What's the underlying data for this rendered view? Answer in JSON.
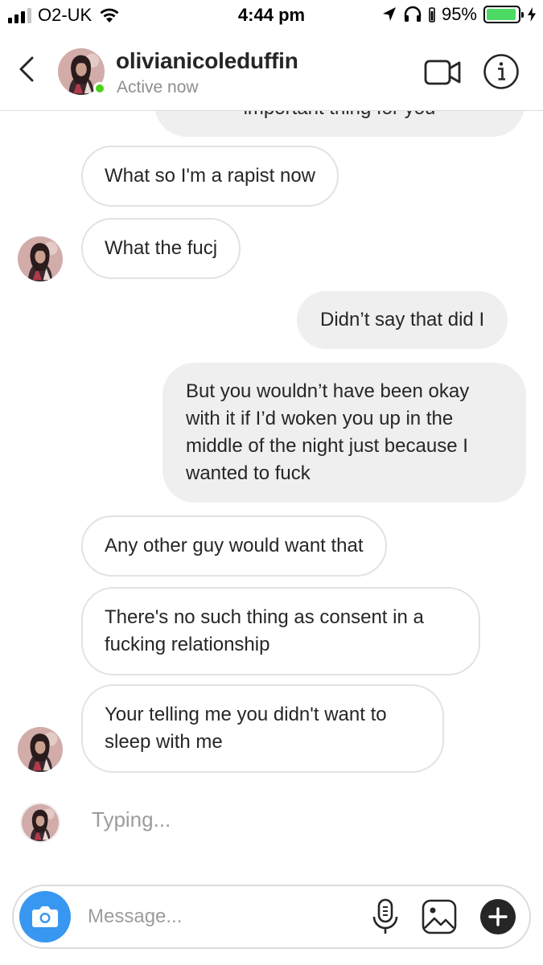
{
  "status_bar": {
    "carrier": "O2-UK",
    "time": "4:44 pm",
    "battery_percent": "95%",
    "battery_level": 0.95,
    "signal_bars": 3,
    "icons": [
      "signal-icon",
      "wifi-icon",
      "location-arrow-icon",
      "headphones-icon",
      "battery-icon",
      "charging-icon"
    ]
  },
  "header": {
    "username": "olivianicoleduffin",
    "status": "Active now",
    "icons": [
      "back-chevron-icon",
      "video-call-icon",
      "info-icon"
    ],
    "online_color": "#4bd11b"
  },
  "messages": [
    {
      "from": "me",
      "text": "important thing for you",
      "partially_hidden": true
    },
    {
      "from": "them",
      "text": "What so I'm a rapist now"
    },
    {
      "from": "them",
      "text": "What the fucj"
    },
    {
      "from": "me",
      "text": "Didn’t say that did I"
    },
    {
      "from": "me",
      "text": "But you wouldn’t have been okay with it if I’d woken you up in the middle of the night just because I wanted to fuck"
    },
    {
      "from": "them",
      "text": "Any other guy would want that"
    },
    {
      "from": "them",
      "text": "There's no such thing as consent in a fucking relationship"
    },
    {
      "from": "them",
      "text": "Your telling me you didn't want to sleep with me"
    }
  ],
  "typing_indicator": "Typing...",
  "composer": {
    "placeholder": "Message...",
    "icons": [
      "camera-icon",
      "microphone-icon",
      "gallery-icon",
      "plus-icon"
    ],
    "camera_color": "#3897f0"
  },
  "colors": {
    "outgoing_bubble": "#efefef",
    "incoming_border": "#e2e2e2",
    "text": "#262626",
    "secondary_text": "#8e8e8e"
  }
}
